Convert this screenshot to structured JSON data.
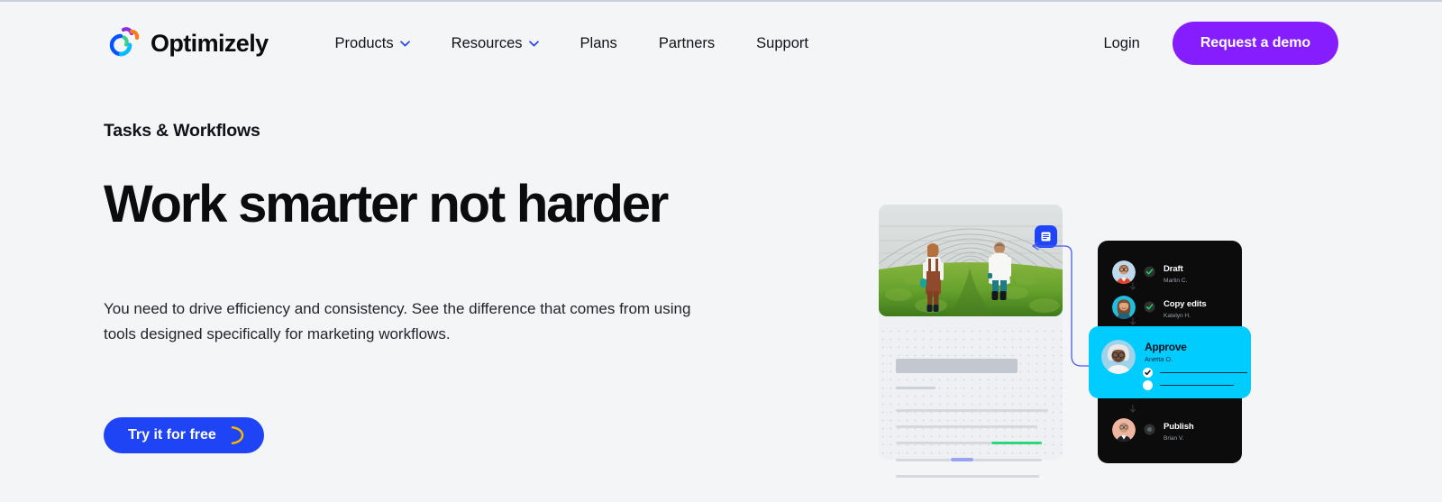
{
  "brand": {
    "name": "Optimizely",
    "logo_icon": "optimizely-logo-icon"
  },
  "nav": {
    "links": [
      {
        "label": "Products",
        "has_chevron": true
      },
      {
        "label": "Resources",
        "has_chevron": true
      },
      {
        "label": "Plans",
        "has_chevron": false
      },
      {
        "label": "Partners",
        "has_chevron": false
      },
      {
        "label": "Support",
        "has_chevron": false
      }
    ],
    "login_label": "Login",
    "demo_label": "Request a demo",
    "demo_color": "#861dff",
    "chevron_color": "#1f44f5"
  },
  "hero": {
    "eyebrow": "Tasks & Workflows",
    "headline": "Work smarter not harder",
    "subcopy": "You need to drive efficiency and consistency. See the difference that comes from using tools designed specifically for marketing workflows.",
    "cta_label": "Try it for free",
    "cta_color": "#1f44f5",
    "cta_icon": "crescent-moon-icon",
    "cta_icon_color": "#f5b700"
  },
  "illustration": {
    "photo_alt": "greenhouse-workers-photo",
    "comment_badge_icon": "comment-document-icon",
    "comment_badge_color": "#1f44f5",
    "connector_color": "#4a5bf0",
    "document": {
      "highlight_green": "#2bd97c",
      "highlight_blue": "#9aa3f0"
    },
    "workflow": {
      "card_color": "#0c0c0c",
      "active_color": "#00ccff",
      "steps": [
        {
          "title": "Draft",
          "assignee": "Martin C.",
          "status": "done",
          "status_icon": "check-circle-icon"
        },
        {
          "title": "Copy edits",
          "assignee": "Katelyn H.",
          "status": "done",
          "status_icon": "check-circle-icon"
        },
        {
          "title": "Approve",
          "assignee": "Anetta O.",
          "status": "active",
          "status_icon": "check-circle-icon"
        },
        {
          "title": "Publish",
          "assignee": "Brian V.",
          "status": "pending",
          "status_icon": "dot-circle-icon"
        }
      ]
    }
  }
}
